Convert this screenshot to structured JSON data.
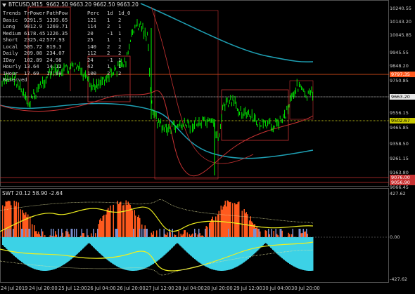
{
  "header": {
    "symbol": "BTCUSD,M15",
    "ohlc": "9662.50 9663.20 9662.50 9663.20"
  },
  "table": {
    "headers": [
      "Trends",
      "TrPower",
      "PathPow",
      "Perc",
      "1d",
      "1d_0"
    ],
    "rows": [
      [
        "Basic",
        "9291.5",
        "1339.65",
        "121",
        "1",
        "2"
      ],
      [
        "Long",
        "9012.9",
        "1269.71",
        "114",
        "2",
        "1"
      ],
      [
        "Medium",
        "6178.45",
        "1226.35",
        "20",
        "-1",
        "1"
      ],
      [
        "Short",
        "2325.42",
        "577.93",
        "25",
        "1",
        "1"
      ],
      [
        "Local",
        "585.72",
        "819.3",
        "140",
        "2",
        "2"
      ],
      [
        "Daily",
        "209.08",
        "234.07",
        "112",
        "2",
        "2"
      ],
      [
        "IDay",
        "102.89",
        "24.98",
        "24",
        "-1",
        "1"
      ],
      [
        "Hourly",
        "13.64",
        "14.12",
        "42",
        "1",
        "1"
      ],
      [
        "IHour",
        "17.69",
        "17.69",
        "100",
        "2",
        "2"
      ],
      [
        "Reserved",
        "",
        "",
        "",
        "",
        ""
      ]
    ]
  },
  "price_axis": {
    "labels": [
      "10240.55",
      "10143.20",
      "10045.85",
      "9945.55",
      "9848.20",
      "9750.85",
      "9656.50",
      "9556.15",
      "9465.85",
      "9358.50",
      "9261.15",
      "9163.80",
      "9066.45"
    ],
    "tags": [
      {
        "text": "9797.35",
        "color": "#ff5a1e",
        "text_color": "#ffffff"
      },
      {
        "text": "9663.20",
        "color": "#e8e8e8",
        "text_color": "#000000"
      },
      {
        "text": "9502.67",
        "color": "#c8c800",
        "text_color": "#000000"
      },
      {
        "text": "9076.00",
        "color": "#c83232",
        "text_color": "#ffffff"
      },
      {
        "text": "9056.90",
        "color": "#c83232",
        "text_color": "#ffffff"
      }
    ]
  },
  "indicator": {
    "label": "SWT 20.12 58.90 -2.64",
    "axis": [
      "427.62",
      "0.00",
      "-427.62"
    ]
  },
  "time_axis": [
    "24 Jul 2019",
    "24 Jul 20:00",
    "25 Jul 12:00",
    "26 Jul 04:00",
    "26 Jul 20:00",
    "27 Jul 12:00",
    "28 Jul 04:00",
    "28 Jul 20:00",
    "29 Jul 12:00",
    "30 Jul 04:00",
    "30 Jul 20:00"
  ],
  "colors": {
    "candles": "#00ff00",
    "ma_long": "#1ea0b4",
    "ma_red": "#c83232",
    "orange": "#ff5a1e",
    "cyan": "#3cd2e6",
    "yellow": "#f0f01e"
  }
}
